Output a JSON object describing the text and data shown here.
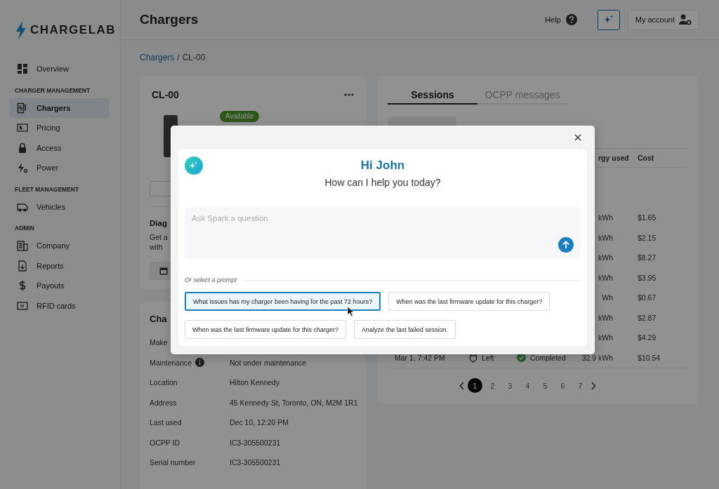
{
  "brand": {
    "name": "CHARGELAB"
  },
  "header": {
    "title": "Chargers",
    "help": "Help",
    "account": "My account"
  },
  "sidebar": {
    "sections": [
      {
        "items": [
          {
            "label": "Overview",
            "selected": false
          }
        ]
      },
      {
        "heading": "CHARGER MANAGEMENT",
        "items": [
          {
            "label": "Chargers",
            "selected": true
          },
          {
            "label": "Pricing",
            "selected": false
          },
          {
            "label": "Access",
            "selected": false
          },
          {
            "label": "Power",
            "selected": false
          }
        ]
      },
      {
        "heading": "FLEET MANAGEMENT",
        "items": [
          {
            "label": "Vehicles",
            "selected": false
          }
        ]
      },
      {
        "heading": "ADMIN",
        "items": [
          {
            "label": "Company",
            "selected": false
          },
          {
            "label": "Reports",
            "selected": false
          },
          {
            "label": "Payouts",
            "selected": false
          },
          {
            "label": "RFID cards",
            "selected": false
          }
        ]
      }
    ]
  },
  "breadcrumb": {
    "link": "Chargers",
    "separator": "/",
    "current": "CL-00"
  },
  "charger_card": {
    "title": "CL-00",
    "status": "Available",
    "diagnostics": {
      "title": "Diag",
      "lines": [
        "Get a",
        "with"
      ]
    }
  },
  "details_card": {
    "title": "Cha",
    "rows": [
      {
        "label": "Make",
        "info": false
      },
      {
        "label": "Maintenance",
        "info": true,
        "value": "Not under maintenance"
      },
      {
        "label": "Location",
        "info": false,
        "value": "Hilton Kennedy"
      },
      {
        "label": "Address",
        "info": false,
        "value": "45 Kennedy St, Toronto, ON, M2M 1R1"
      },
      {
        "label": "Last used",
        "info": false,
        "value": "Dec 10, 12:20 PM"
      },
      {
        "label": "OCPP ID",
        "info": false,
        "value": "IC3-305500231"
      },
      {
        "label": "Serial number",
        "info": false,
        "value": "IC3-305500231"
      }
    ]
  },
  "sessions": {
    "tabs": [
      {
        "label": "Sessions",
        "selected": true
      },
      {
        "label": "OCPP messages",
        "selected": false
      }
    ],
    "columns": [
      "rgy used",
      "Cost"
    ],
    "rows": [
      {
        "energy": "kWh",
        "cost": "$1.65"
      },
      {
        "energy": "kWh",
        "cost": "$2.15"
      },
      {
        "energy": "kWh",
        "cost": "$8.27"
      },
      {
        "energy": "kWh",
        "cost": "$3.95"
      },
      {
        "energy": "Wh",
        "cost": "$0.67"
      },
      {
        "energy": "kWh",
        "cost": "$2.87"
      },
      {
        "energy": "kWh",
        "cost": "$4.29"
      },
      {
        "date": "Mar 1, 7:42 PM",
        "connector": "Left",
        "status": "Completed",
        "energy": "32.9 kWh",
        "cost": "$10.54"
      }
    ],
    "pages": [
      {
        "label": "1",
        "selected": true
      },
      {
        "label": "2",
        "selected": false
      },
      {
        "label": "3",
        "selected": false
      },
      {
        "label": "4",
        "selected": false
      },
      {
        "label": "5",
        "selected": false
      },
      {
        "label": "6",
        "selected": false
      },
      {
        "label": "7",
        "selected": false
      }
    ]
  },
  "modal": {
    "greeting": "Hi John",
    "subtitle": "How can I help you today?",
    "input": {
      "placeholder": "Ask Spark a question"
    },
    "prompts_label": "Or select a prompt",
    "prompts": [
      {
        "text": "What issues has my charger been having for the past 72 hours?",
        "selected": true
      },
      {
        "text": "When was the last firmware update for this charger?",
        "selected": false
      },
      {
        "text": "When was the last firmware update for this charger?",
        "selected": false
      },
      {
        "text": "Analyze the last failed session.",
        "selected": false
      }
    ]
  }
}
